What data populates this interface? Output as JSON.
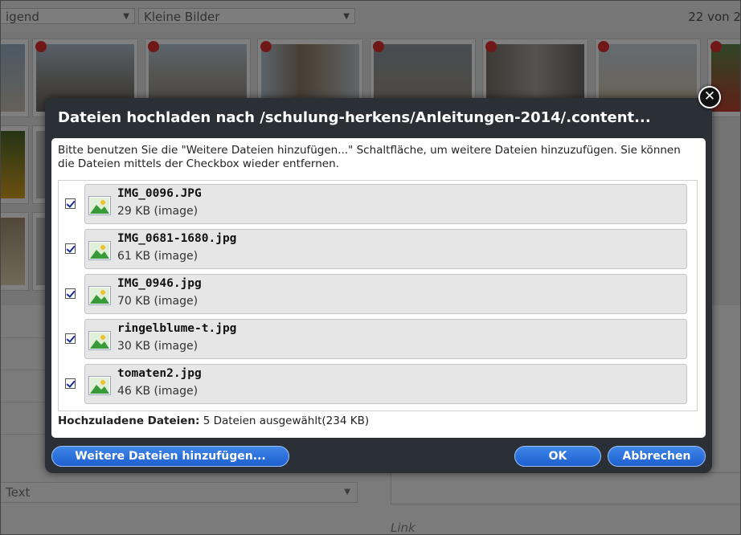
{
  "background": {
    "sort_select_value": "igend",
    "size_select_value": "Kleine Bilder",
    "count_text": "22 von 2",
    "text_select_value": "Text",
    "link_label": "Link"
  },
  "dialog": {
    "title": "Dateien hochladen nach /schulung-herkens/Anleitungen-2014/.content...",
    "instructions": "Bitte benutzen Sie die \"Weitere Dateien hinzufügen...\" Schaltfläche, um weitere Dateien hinzuzufügen. Sie können die Dateien mittels der Checkbox wieder entfernen.",
    "files": [
      {
        "name": "IMG_0096.JPG",
        "size": "29 KB (image)",
        "checked": true
      },
      {
        "name": "IMG_0681-1680.jpg",
        "size": "61 KB (image)",
        "checked": true
      },
      {
        "name": "IMG_0946.jpg",
        "size": "70 KB (image)",
        "checked": true
      },
      {
        "name": "ringelblume-t.jpg",
        "size": "30 KB (image)",
        "checked": true
      },
      {
        "name": "tomaten2.jpg",
        "size": "46 KB (image)",
        "checked": true
      }
    ],
    "summary_label": "Hochzuladene Dateien:",
    "summary_value": "5 Dateien ausgewählt(234 KB)",
    "add_button": "Weitere Dateien hinzufügen...",
    "ok_button": "OK",
    "cancel_button": "Abbrechen",
    "close_glyph": "✕"
  },
  "colors": {
    "dialog_bg": "#2b2f36",
    "button_blue": "#1d5fcf",
    "file_card": "#e6e6e6"
  },
  "icons": {
    "close": "close-icon",
    "file": "image-file-icon",
    "checkbox": "checkbox-checked-icon",
    "dropdown": "chevron-down-icon"
  }
}
